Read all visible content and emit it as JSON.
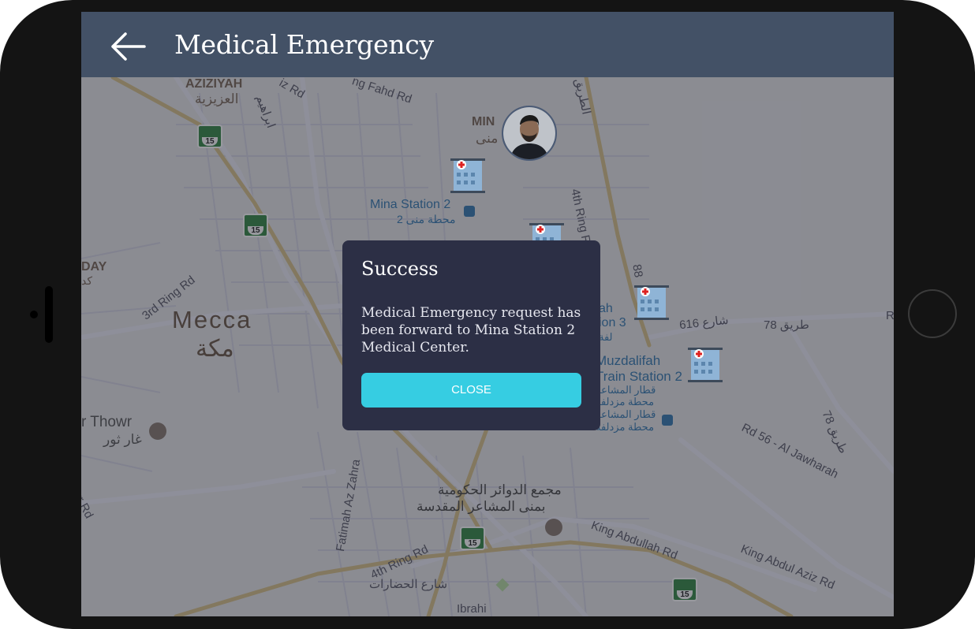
{
  "header": {
    "title": "Medical Emergency"
  },
  "map": {
    "labels": {
      "aziziyah_en": "AZIZIYAH",
      "aziziyah_ar": "العزيزية",
      "mina_en": "MIN",
      "mina_ar": "منى",
      "mecca_en": "Mecca",
      "mecca_ar": "مكة",
      "mina_station_en": "Mina Station 2",
      "mina_station_ar": "محطة منى 2",
      "muzdalifah_en": "Muzdalifah",
      "train_station_en": "Train Station 2",
      "muzdalifah_ar1": "قطار المشاعر",
      "muzdalifah_ar2": "محطة مزدلفة",
      "muzdalifah_ar3": "قطار المشاعر",
      "muzdalifah_ar4": "محطة مزدلفة",
      "station3_a": "ah",
      "station3_b": "ion 3",
      "station3_ar": "لفة",
      "thowr_en": "r Thowr",
      "thowr_ar": "غار ثور",
      "day": "DAY",
      "day_ar": "كد",
      "gov_ar1": "مجمع الدوائر الحكومية",
      "gov_ar2": "بمنى المشاعر المقدسة",
      "street_ar": "شارع الحضارات",
      "road_fahd": "ng Fahd Rd",
      "road_iz": "iz Rd",
      "road_4th_ring_top": "4th Ring Rd",
      "road_3rd_ring": "3rd Ring Rd",
      "road_616": "شارع 616",
      "road_78": "طريق 78",
      "road_78b": "طريق 78",
      "road_56": "Rd 56 - Al Jawharah",
      "road_king_abdullah": "King Abdullah Rd",
      "road_king_abdul_aziz": "King Abdul Aziz Rd",
      "road_4th_ring_bottom": "4th Ring Rd",
      "road_fatimah": "Fatimah Az Zahra",
      "road_ibrahim": "Ibrahi",
      "road_wr": "wr Rd",
      "road_88": "88",
      "road_r": "R",
      "road_ar_top": "الطريق",
      "road_ar_left": "ابراهيم",
      "shield": "15"
    }
  },
  "dialog": {
    "title": "Success",
    "message": "Medical Emergency request has been forward to Mina Station 2 Medical Center.",
    "close_label": "CLOSE"
  },
  "icons": {
    "back": "arrow-left-icon",
    "hospital": "hospital-icon",
    "highway_shield": "highway-shield-icon"
  },
  "colors": {
    "topbar": "#435166",
    "dialog_bg": "#2c2f45",
    "close_button": "#36cde2"
  }
}
